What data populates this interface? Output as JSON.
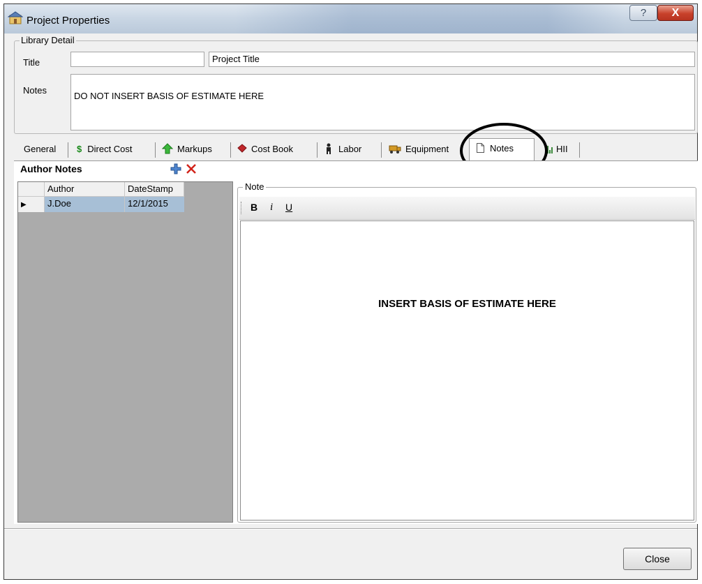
{
  "window": {
    "title": "Project Properties",
    "help_glyph": "?",
    "close_glyph": "X"
  },
  "library_detail": {
    "legend": "Library Detail",
    "title_label": "Title",
    "title_value": "",
    "title_hint": "Project Title",
    "notes_label": "Notes",
    "notes_value": "DO NOT INSERT BASIS OF ESTIMATE HERE"
  },
  "tabs": [
    {
      "label": "General",
      "icon": "none"
    },
    {
      "label": "Direct Cost",
      "icon": "dollar-icon"
    },
    {
      "label": "Markups",
      "icon": "up-arrow-icon"
    },
    {
      "label": "Cost Book",
      "icon": "book-icon"
    },
    {
      "label": "Labor",
      "icon": "worker-icon"
    },
    {
      "label": "Equipment",
      "icon": "truck-icon"
    },
    {
      "label": "Notes",
      "icon": "document-icon"
    },
    {
      "label": "HII",
      "icon": "chart-icon"
    }
  ],
  "active_tab": "Notes",
  "author_notes": {
    "heading": "Author Notes",
    "columns": [
      "Author",
      "DateStamp"
    ],
    "rows": [
      {
        "author": "J.Doe",
        "datestamp": "12/1/2015"
      }
    ]
  },
  "note_panel": {
    "legend": "Note",
    "bold_label": "B",
    "italic_label": "i",
    "underline_label": "U",
    "content": "INSERT BASIS OF ESTIMATE HERE"
  },
  "footer": {
    "close_label": "Close"
  },
  "colors": {
    "grid_background": "#ababab",
    "selected_row": "#a7bfd6",
    "close_x": "#d2231a",
    "plus_icon": "#2f6fc2"
  }
}
